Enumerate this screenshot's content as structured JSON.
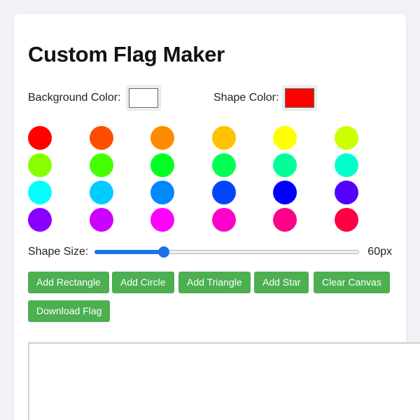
{
  "title": "Custom Flag Maker",
  "background_color": {
    "label": "Background Color:",
    "value": "#ffffff"
  },
  "shape_color": {
    "label": "Shape Color:",
    "value": "#ff0000"
  },
  "palette": [
    "#ff0000",
    "#ff4d00",
    "#ff8c00",
    "#ffc400",
    "#ffff00",
    "#ccff00",
    "#88ff00",
    "#44ff00",
    "#00ff22",
    "#00ff55",
    "#00ff99",
    "#00ffcc",
    "#00ffff",
    "#00ccff",
    "#0088ff",
    "#0044ff",
    "#0000ff",
    "#5500ff",
    "#8800ff",
    "#cc00ff",
    "#ff00ff",
    "#ff00cc",
    "#ff0088",
    "#ff0044"
  ],
  "shape_size": {
    "label": "Shape Size:",
    "value": 60,
    "min": 10,
    "max": 200,
    "display": "60px"
  },
  "buttons": {
    "add_rectangle": "Add Rectangle",
    "add_circle": "Add Circle",
    "add_triangle": "Add Triangle",
    "add_star": "Add Star",
    "clear_canvas": "Clear Canvas",
    "download_flag": "Download Flag"
  },
  "colors": {
    "button": "#4caf50",
    "slider": "#1a73e8",
    "page_bg": "#f0f2f6"
  }
}
